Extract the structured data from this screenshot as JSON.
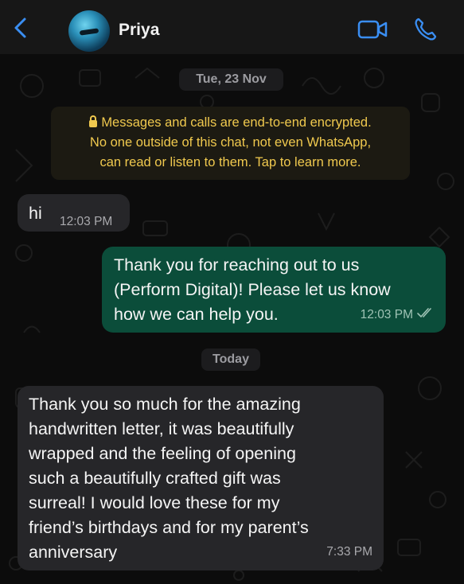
{
  "header": {
    "contact_name": "Priya",
    "back_icon": "chevron-left-icon",
    "video_icon": "video-camera-icon",
    "call_icon": "phone-icon",
    "accent_color": "#3a8ef2"
  },
  "chat": {
    "date_separator": "Tue, 23 Nov",
    "encryption_notice": {
      "line1": "Messages and calls are end-to-end encrypted.",
      "line2": "No one outside of this chat, not even WhatsApp,",
      "line3": "can read or listen to them. Tap to learn more."
    },
    "messages": [
      {
        "direction": "incoming",
        "text": "hi",
        "time": "12:03 PM"
      },
      {
        "direction": "outgoing",
        "lines": [
          "Thank you for reaching out to us",
          "(Perform Digital)! Please let us know",
          "how we can help you."
        ],
        "time": "12:03 PM",
        "status": "read"
      }
    ],
    "today_separator": "Today",
    "latest_message": {
      "direction": "incoming",
      "lines": [
        "Thank you so much for the amazing",
        "handwritten letter, it was beautifully",
        "wrapped and the feeling of opening",
        "such a beautifully crafted gift was",
        "surreal! I would love these for my",
        "friend’s birthdays and for my parent’s",
        "anniversary"
      ],
      "time": "7:33 PM"
    }
  }
}
